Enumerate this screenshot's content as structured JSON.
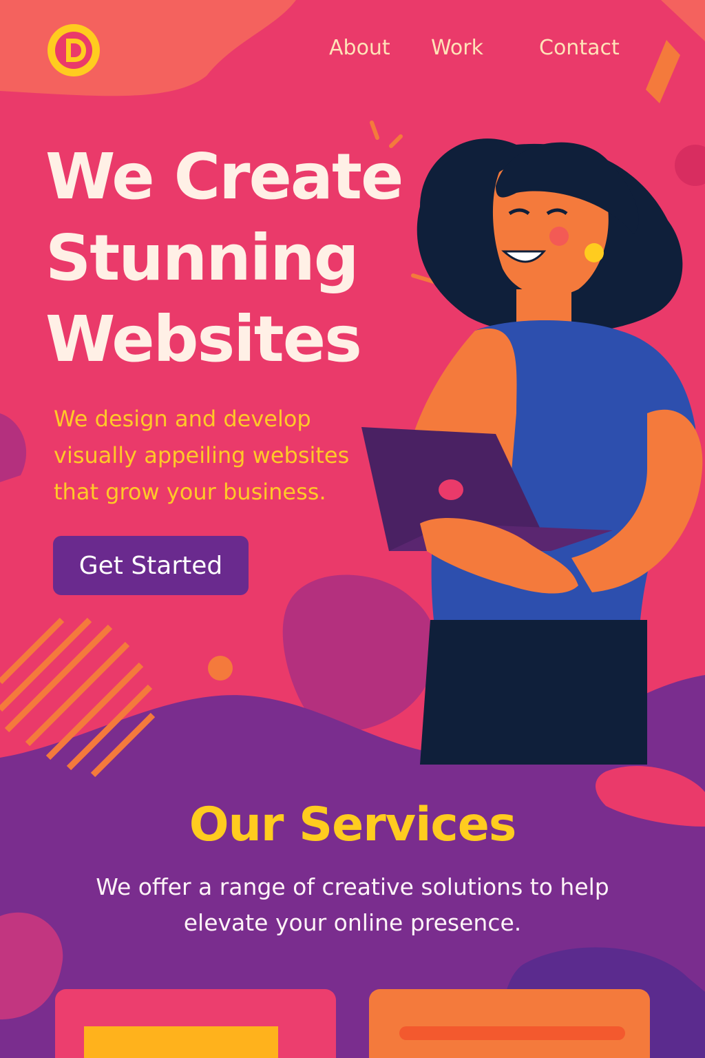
{
  "colors": {
    "background": "#ea3a6a",
    "accent_yellow": "#ffcc1f",
    "accent_purple": "#6a2a8e",
    "accent_orange": "#f47a3c"
  },
  "header": {
    "logo_icon": "logo-d-icon",
    "nav": [
      {
        "label": "About"
      },
      {
        "label": "Work"
      },
      {
        "label": "Contact"
      }
    ]
  },
  "hero": {
    "title_lines": [
      "We Create",
      "Stunning",
      "Websites"
    ],
    "subtitle_lines": [
      "We design and develop",
      "visually appeiling websites",
      "that grow your business."
    ],
    "cta_label": "Get Started"
  },
  "services": {
    "title": "Our Services",
    "description_lines": [
      "We offer a range of creative solutions to help",
      "elevate your online presence."
    ]
  }
}
